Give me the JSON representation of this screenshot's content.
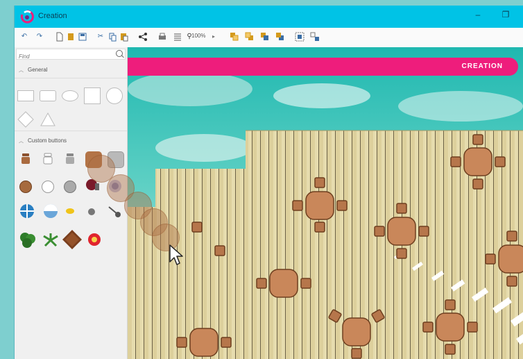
{
  "window": {
    "title": "Creation",
    "minimize_symbol": "–",
    "restore_symbol": "❐",
    "titlebar_color": "#00c3e6"
  },
  "toolbar": {
    "zoom_level": "100%",
    "icons": [
      "undo-icon",
      "redo-icon",
      "new-document-icon",
      "open-icon",
      "save-icon",
      "cut-icon",
      "copy-icon",
      "paste-icon",
      "share-icon",
      "print-icon",
      "grid-icon",
      "zoom-icon",
      "zoom-dropdown-icon",
      "bring-front-icon",
      "send-back-icon",
      "bring-forward-icon",
      "send-backward-icon",
      "group-icon",
      "ungroup-icon"
    ]
  },
  "sidebar": {
    "search_placeholder": "Find",
    "general_label": "General",
    "custom_label": "Custom buttons"
  },
  "canvas": {
    "banner_text": "CREATION",
    "banner_color": "#ee1d7c",
    "table_color": "#c9875a",
    "chair_color": "#b6764b"
  }
}
